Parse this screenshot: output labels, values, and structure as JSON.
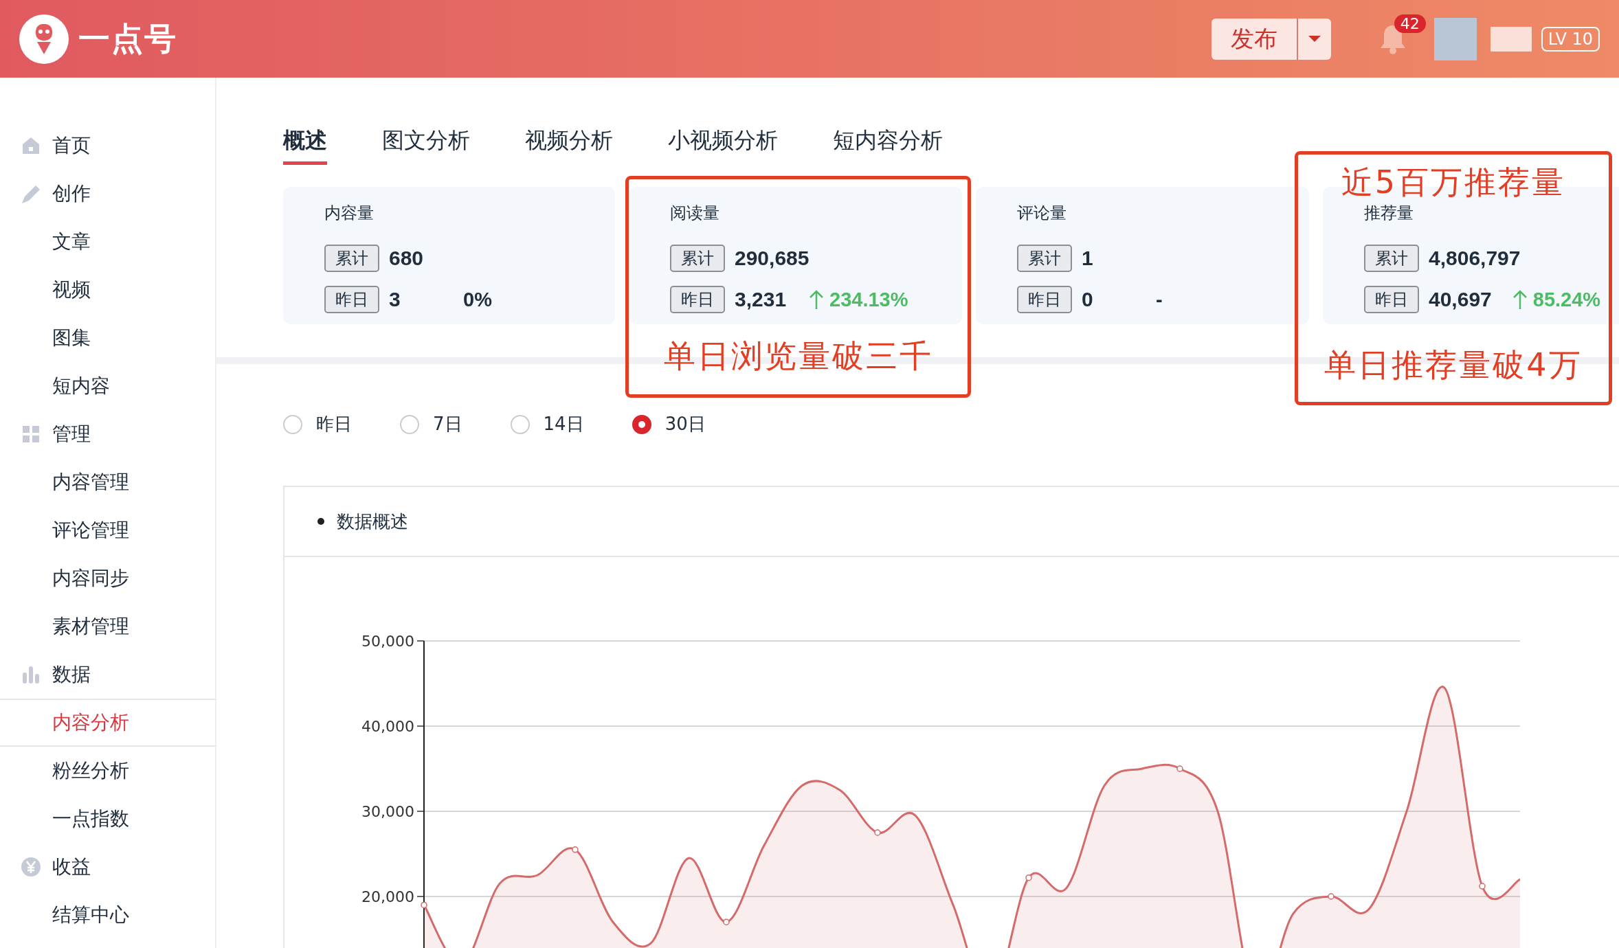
{
  "header": {
    "logo_text": "一点号",
    "publish_button": "发布",
    "notification_count": "42",
    "level_badge": "LV 10"
  },
  "sidebar": {
    "items": [
      {
        "label": "首页",
        "kind": "home",
        "selected": false
      },
      {
        "label": "创作",
        "kind": "pen",
        "selected": false,
        "children": [
          {
            "label": "文章",
            "selected": false
          },
          {
            "label": "视频",
            "selected": false
          },
          {
            "label": "图集",
            "selected": false
          },
          {
            "label": "短内容",
            "selected": false
          }
        ]
      },
      {
        "label": "管理",
        "kind": "grid",
        "selected": false,
        "children": [
          {
            "label": "内容管理",
            "selected": false
          },
          {
            "label": "评论管理",
            "selected": false
          },
          {
            "label": "内容同步",
            "selected": false
          },
          {
            "label": "素材管理",
            "selected": false
          }
        ]
      },
      {
        "label": "数据",
        "kind": "bars",
        "selected": false,
        "children": [
          {
            "label": "内容分析",
            "selected": true
          },
          {
            "label": "粉丝分析",
            "selected": false
          },
          {
            "label": "一点指数",
            "selected": false
          }
        ]
      },
      {
        "label": "收益",
        "kind": "yen",
        "selected": false,
        "children": [
          {
            "label": "结算中心",
            "selected": false
          }
        ]
      }
    ]
  },
  "tabs": [
    {
      "label": "概述",
      "selected": true
    },
    {
      "label": "图文分析",
      "selected": false
    },
    {
      "label": "视频分析",
      "selected": false
    },
    {
      "label": "小视频分析",
      "selected": false
    },
    {
      "label": "短内容分析",
      "selected": false
    }
  ],
  "stat_cards": [
    {
      "title": "内容量",
      "total_tag": "累计",
      "total": "680",
      "yesterday_tag": "昨日",
      "yesterday": "3",
      "change": "0%",
      "kind": "flat"
    },
    {
      "title": "阅读量",
      "total_tag": "累计",
      "total": "290,685",
      "yesterday_tag": "昨日",
      "yesterday": "3,231",
      "change": "234.13%",
      "kind": "up"
    },
    {
      "title": "评论量",
      "total_tag": "累计",
      "total": "1",
      "yesterday_tag": "昨日",
      "yesterday": "0",
      "change": "-",
      "kind": "flat"
    },
    {
      "title": "推荐量",
      "total_tag": "累计",
      "total": "4,806,797",
      "yesterday_tag": "昨日",
      "yesterday": "40,697",
      "change": "85.24%",
      "kind": "up"
    }
  ],
  "range_options": [
    {
      "label": "昨日",
      "selected": false
    },
    {
      "label": "7日",
      "selected": false
    },
    {
      "label": "14日",
      "selected": false
    },
    {
      "label": "30日",
      "selected": true
    }
  ],
  "chart_panel": {
    "title": "数据概述",
    "chart_data": {
      "type": "area",
      "grid": true,
      "ylim": [
        0,
        50000
      ],
      "yticks": [
        {
          "value": 20000,
          "label": "20,000"
        },
        {
          "value": 30000,
          "label": "30,000"
        },
        {
          "value": 40000,
          "label": "40,000"
        },
        {
          "value": 50000,
          "label": "50,000"
        }
      ],
      "series": [
        {
          "color": "#d46a6a",
          "values": [
            19000,
            12000,
            21500,
            22500,
            25500,
            17000,
            14500,
            24500,
            17000,
            26000,
            33000,
            32500,
            27500,
            29500,
            19000,
            8000,
            22200,
            21000,
            33000,
            35000,
            35000,
            30000,
            8000,
            18000,
            20000,
            18500,
            30000,
            44500,
            21200,
            22000
          ]
        }
      ]
    }
  },
  "annotations": [
    {
      "texts": [
        "单日浏览量破三千"
      ]
    },
    {
      "texts": [
        "近5百万推荐量",
        "单日推荐量破4万"
      ]
    }
  ]
}
